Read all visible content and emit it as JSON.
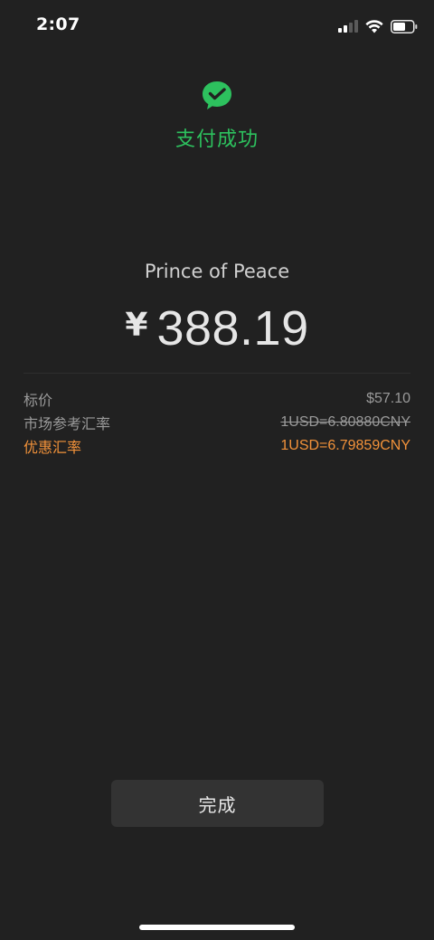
{
  "status_bar": {
    "time": "2:07"
  },
  "colors": {
    "success_green": "#2dc15e",
    "highlight_orange": "#f2923a",
    "background": "#212121"
  },
  "header": {
    "icon": "wechat-pay-icon",
    "title": "支付成功"
  },
  "payment": {
    "merchant": "Prince of Peace",
    "currency_symbol": "¥",
    "amount": "388.19"
  },
  "details": [
    {
      "label": "标价",
      "value": "$57.10"
    },
    {
      "label": "市场参考汇率",
      "value": "1USD=6.80880CNY"
    },
    {
      "label": "优惠汇率",
      "value": "1USD=6.79859CNY"
    }
  ],
  "actions": {
    "done_label": "完成"
  }
}
